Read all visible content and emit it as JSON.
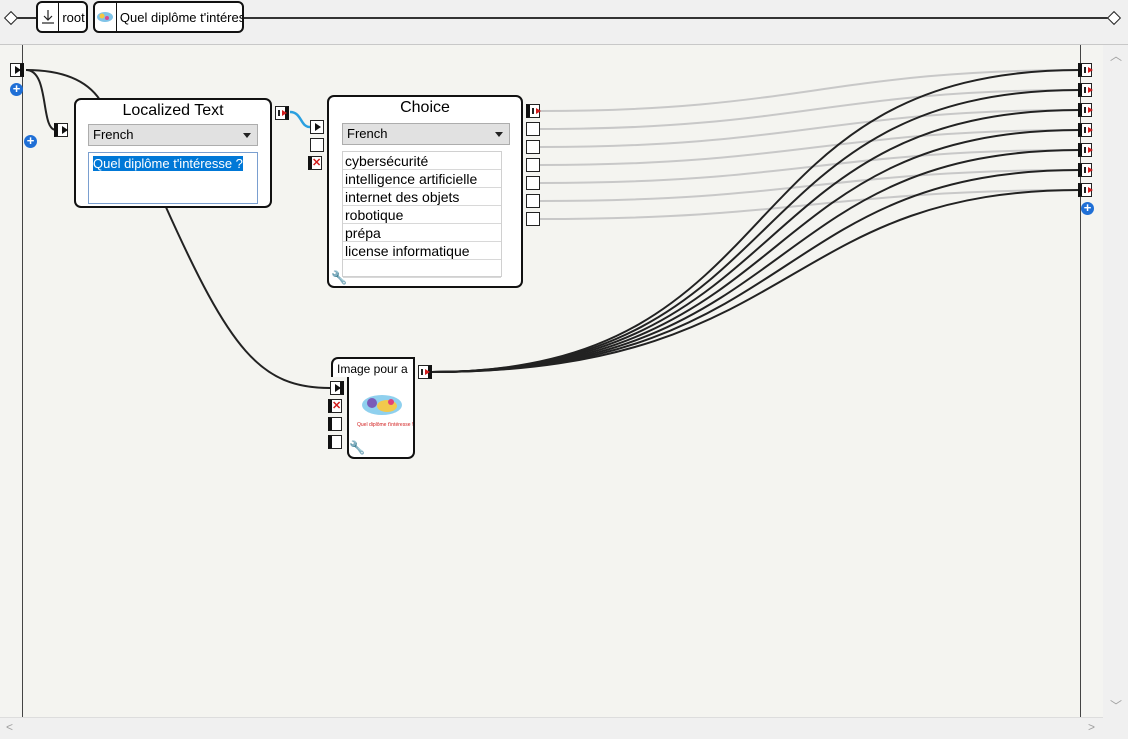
{
  "breadcrumb": {
    "root_label": "root",
    "current_label": "Quel diplôme t'intéres"
  },
  "localized_text_box": {
    "title": "Localized Text",
    "language": "French",
    "text": "Quel diplôme t'intéresse ?"
  },
  "choice_box": {
    "title": "Choice",
    "language": "French",
    "choices": [
      "cybersécurité",
      "intelligence artificielle",
      "internet des objets",
      "robotique",
      "prépa",
      "license informatique",
      ""
    ]
  },
  "image_box": {
    "title": "Image pour a",
    "thumbnail_caption": "Quel diplôme t'intéresse !"
  },
  "icons": {
    "play": "play-icon",
    "output": "output-arrow-icon",
    "stop": "stop-x-icon",
    "add": "plus-icon",
    "settings": "wrench-icon"
  },
  "colors": {
    "wire": "#222222",
    "wire_inactive": "#c8c8c8",
    "selected_wire": "#2aa0e0",
    "selection": "#0078d7",
    "add_button": "#1f6fd6"
  }
}
